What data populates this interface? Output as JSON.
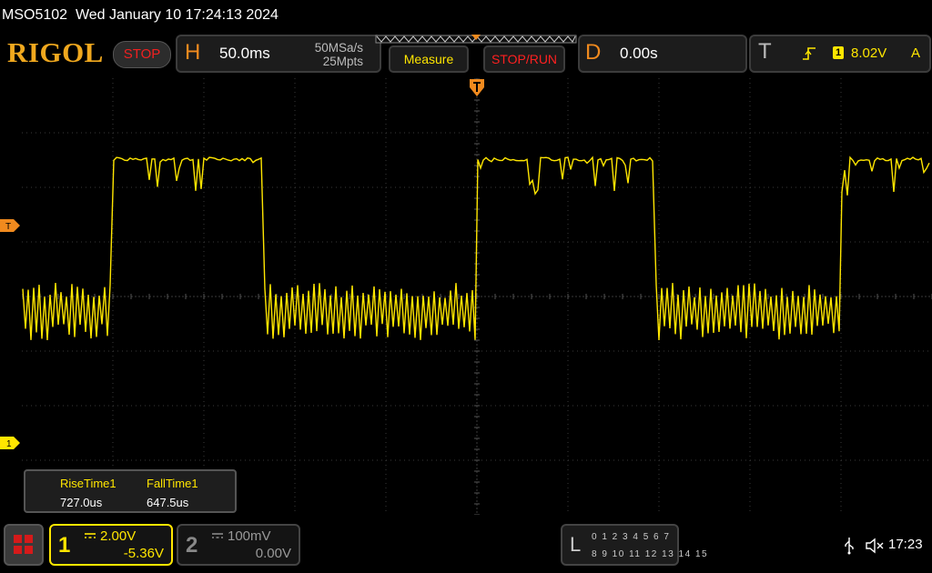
{
  "status": {
    "model": "MSO5102",
    "datetime": "Wed January 10 17:24:13 2024"
  },
  "header": {
    "logo": "RIGOL",
    "run_state": "STOP",
    "horizontal": {
      "letter": "H",
      "timebase": "50.0ms",
      "sample_rate": "50MSa/s",
      "memory_depth": "25Mpts"
    },
    "measure_label": "Measure",
    "stoprun_label": "STOP/RUN",
    "delay": {
      "letter": "D",
      "value": "0.00s"
    },
    "trigger": {
      "letter": "T",
      "source": "1",
      "level": "8.02V",
      "mode": "A"
    }
  },
  "markers": {
    "trigger_level_label": "T",
    "ch1_label": "1"
  },
  "measurements": [
    {
      "name": "RiseTime1",
      "value": "727.0us"
    },
    {
      "name": "FallTime1",
      "value": "647.5us"
    }
  ],
  "channels": [
    {
      "number": "1",
      "scale": "2.00V",
      "offset": "-5.36V",
      "color": "#ffe600"
    },
    {
      "number": "2",
      "scale": "100mV",
      "offset": "0.00V",
      "color": "#888888"
    }
  ],
  "logic": {
    "letter": "L",
    "row1": "0 1 2 3  4 5 6 7",
    "row2": "8  9 10 11  12 13 14 15"
  },
  "system": {
    "time": "17:23"
  },
  "colors": {
    "ch1": "#ffe600",
    "trigger": "#f08a1e",
    "stop": "#f02020",
    "grid": "#3a3a3a"
  },
  "chart_data": {
    "type": "line",
    "series": [
      {
        "channel": "1",
        "shape": "square-wave",
        "segments": [
          {
            "level": "low",
            "t_start": -250.0,
            "t_end": -200.0
          },
          {
            "level": "high",
            "t_start": -200.0,
            "t_end": -117.0
          },
          {
            "level": "low",
            "t_start": -117.0,
            "t_end": 0.0
          },
          {
            "level": "high",
            "t_start": 0.0,
            "t_end": 98.0
          },
          {
            "level": "low",
            "t_start": 98.0,
            "t_end": 200.0
          },
          {
            "level": "high",
            "t_start": 200.0,
            "t_end": 250.0
          }
        ],
        "high_level_div": 2.55,
        "low_level_div": -0.25,
        "high_ripple_div": 0.7,
        "low_ripple_div": 1.0
      }
    ],
    "x_range_ms": [
      -250,
      250
    ],
    "y_range_div": [
      -4,
      4
    ],
    "grid": true
  }
}
